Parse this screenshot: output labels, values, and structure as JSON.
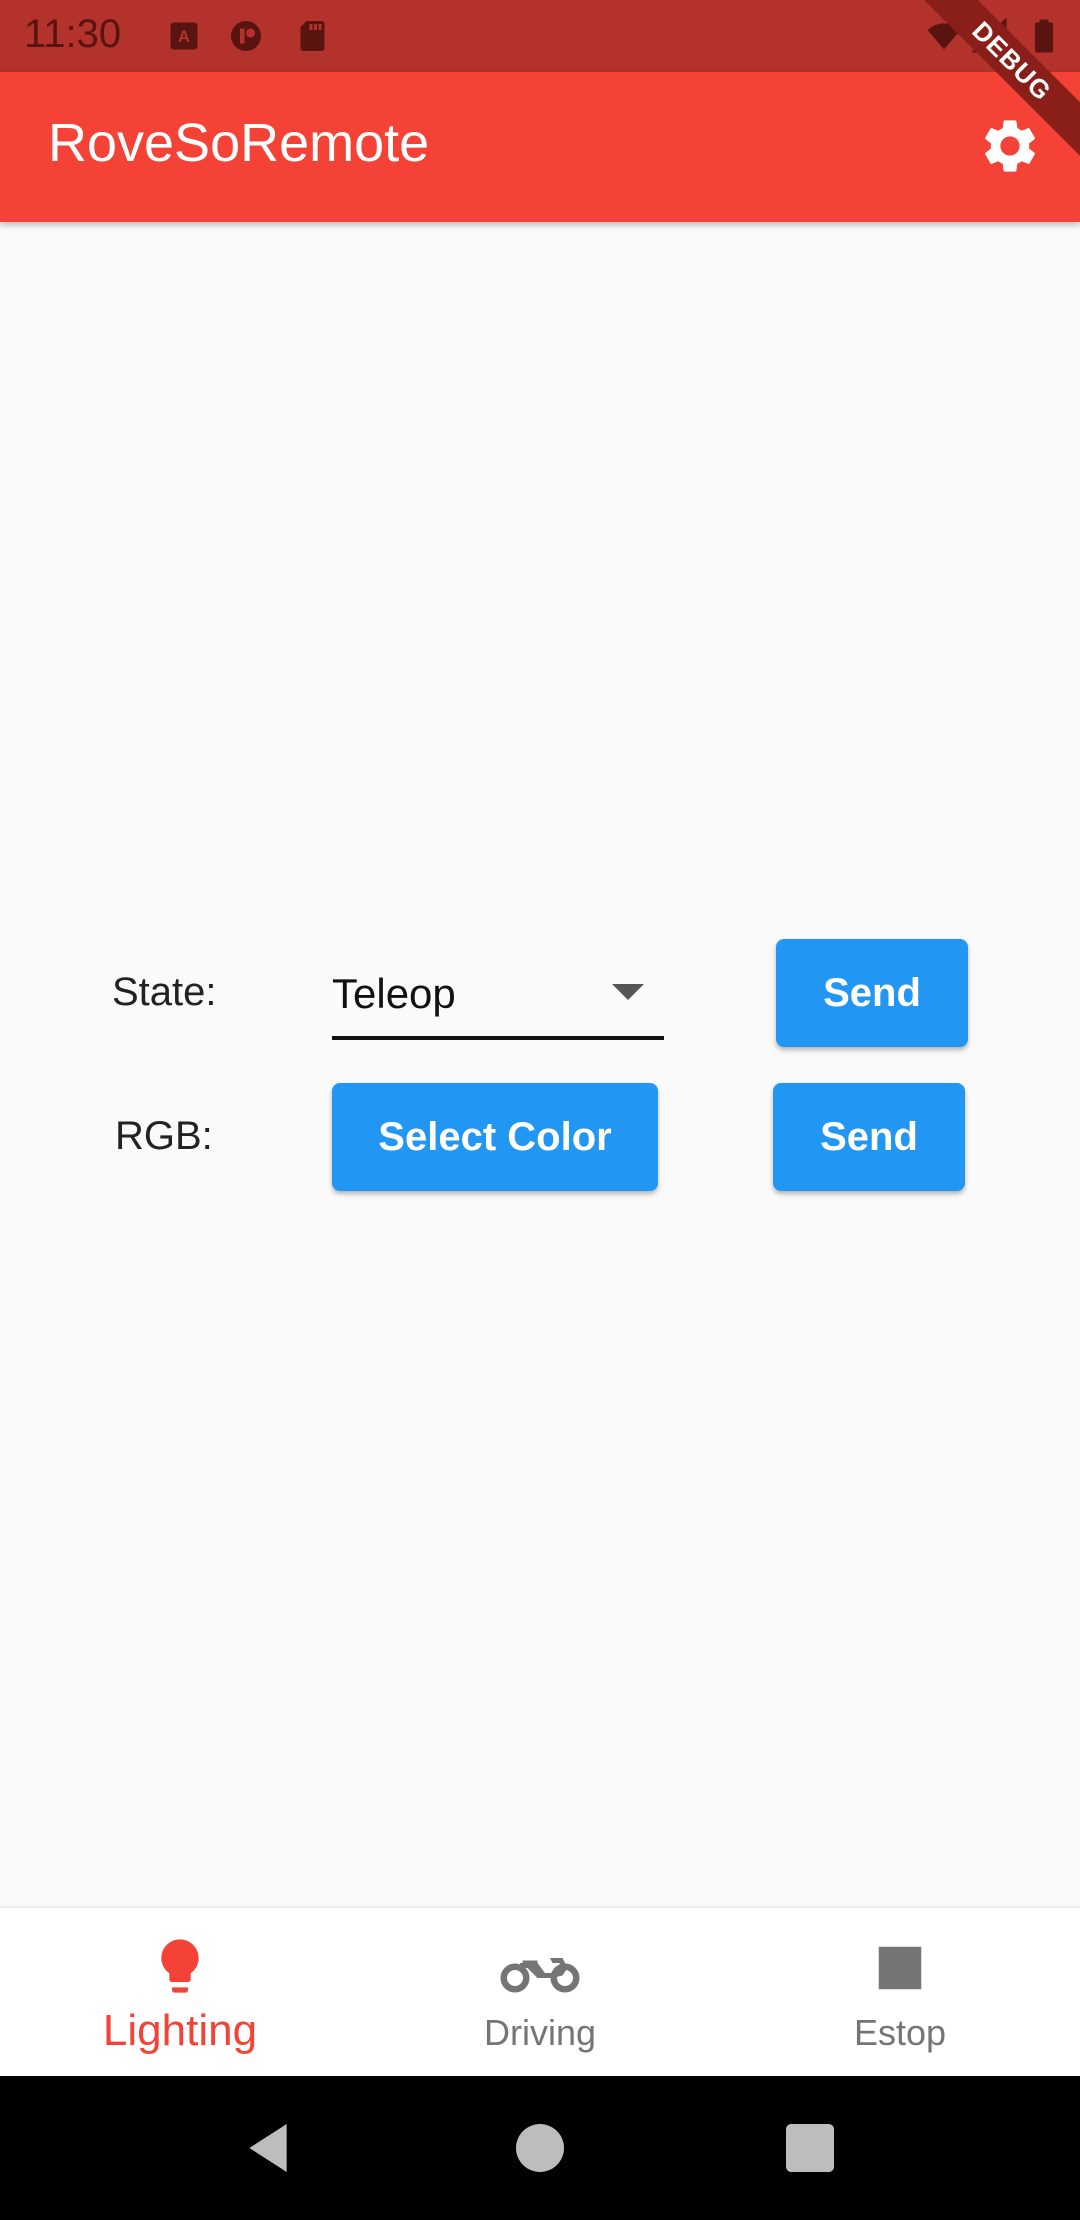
{
  "status_bar": {
    "time": "11:30",
    "icons": [
      "a-box-icon",
      "cast-icon",
      "sd-card-icon",
      "wifi-icon",
      "signal-icon",
      "battery-icon"
    ]
  },
  "debug_banner": "DEBUG",
  "app_bar": {
    "title": "RoveSoRemote",
    "settings_icon": "gear-icon",
    "background": "#f44336"
  },
  "form": {
    "state": {
      "label": "State:",
      "selected": "Teleop",
      "send_label": "Send"
    },
    "rgb": {
      "label": "RGB:",
      "select_color_label": "Select Color",
      "send_label": "Send"
    },
    "button_color": "#2196f3"
  },
  "bottom_nav": {
    "active_color": "#f44336",
    "inactive_color": "#757575",
    "items": [
      {
        "label": "Lighting",
        "icon": "lightbulb-icon",
        "active": true
      },
      {
        "label": "Driving",
        "icon": "motorcycle-icon",
        "active": false
      },
      {
        "label": "Estop",
        "icon": "stop-icon",
        "active": false
      }
    ]
  },
  "system_nav": {
    "buttons": [
      "back-icon",
      "home-icon",
      "recents-icon"
    ]
  }
}
